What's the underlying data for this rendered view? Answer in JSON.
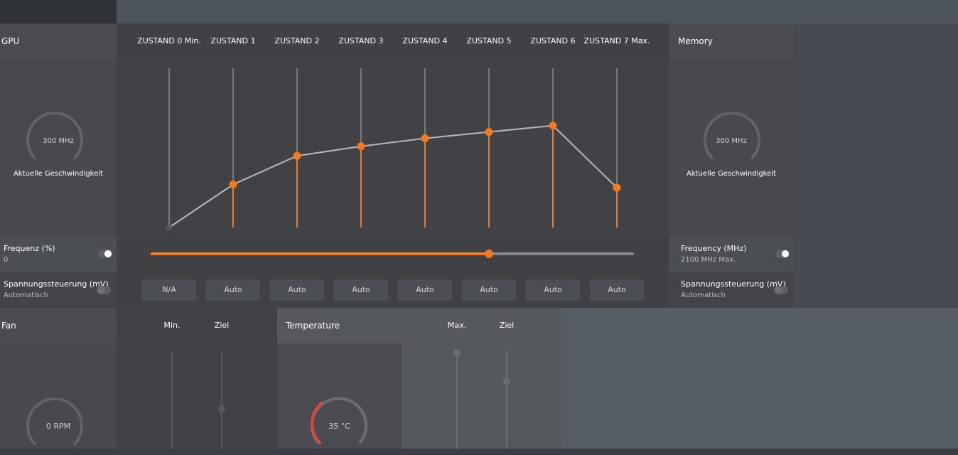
{
  "gpu": {
    "title": "GPU",
    "gauge_value": "300 MHz",
    "gauge_caption": "Aktuelle Geschwindigkeit",
    "freq_title": "Frequenz (%)",
    "freq_value": "0",
    "volt_title": "Spannungssteuerung (mV)",
    "volt_value": "Automatisch"
  },
  "states": {
    "labels": [
      "ZUSTAND 0 Min.",
      "ZUSTAND 1",
      "ZUSTAND 2",
      "ZUSTAND 3",
      "ZUSTAND 4",
      "ZUSTAND 5",
      "ZUSTAND 6",
      "ZUSTAND 7 Max."
    ],
    "levels": [
      0.0,
      0.27,
      0.45,
      0.51,
      0.56,
      0.6,
      0.64,
      0.25
    ],
    "voltages": [
      "N/A",
      "Auto",
      "Auto",
      "Auto",
      "Auto",
      "Auto",
      "Auto",
      "Auto"
    ]
  },
  "frequency_slider": {
    "value_fraction": 0.7
  },
  "memory": {
    "title": "Memory",
    "gauge_value": "300 MHz",
    "gauge_caption": "Aktuelle Geschwindigkeit",
    "freq_title": "Frequency (MHz)",
    "freq_value": "2100 MHz Max.",
    "volt_title": "Spannungssteuerung (mV)",
    "volt_value": "Automatisch"
  },
  "fan": {
    "title": "Fan",
    "col_min": "Min.",
    "col_target": "Ziel",
    "gauge_value": "0 RPM"
  },
  "temperature": {
    "title": "Temperature",
    "col_max": "Max.",
    "col_target": "Ziel",
    "gauge_value": "35 °C",
    "gauge_fraction": 0.35
  },
  "colors": {
    "accent": "#f37b1d",
    "temp_gauge": "#e0463a",
    "curve": "#b9b9b9"
  }
}
